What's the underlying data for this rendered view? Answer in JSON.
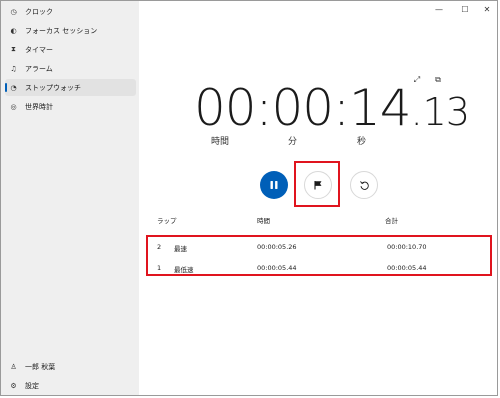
{
  "window": {
    "minimize_glyph": "—",
    "maximize_glyph": "☐",
    "close_glyph": "✕"
  },
  "sidebar": {
    "items": [
      {
        "label": "クロック",
        "icon": "clock-app-icon",
        "glyph": "◷"
      },
      {
        "label": "フォーカス セッション",
        "icon": "focus-icon",
        "glyph": "◐"
      },
      {
        "label": "タイマー",
        "icon": "hourglass-icon",
        "glyph": "⧗"
      },
      {
        "label": "アラーム",
        "icon": "bell-icon",
        "glyph": "♫"
      },
      {
        "label": "ストップウォッチ",
        "icon": "stopwatch-icon",
        "glyph": "◔",
        "active": true
      },
      {
        "label": "世界時計",
        "icon": "globe-icon",
        "glyph": "◎"
      }
    ],
    "user": {
      "label": "一郎 秋葉",
      "icon": "person-icon",
      "glyph": "♙"
    },
    "settings": {
      "label": "設定",
      "icon": "gear-icon",
      "glyph": "⚙"
    }
  },
  "stopwatch": {
    "time_main": "00:00:14",
    "time_dot": ".",
    "time_frac": "13",
    "units": {
      "hours": "時間",
      "minutes": "分",
      "seconds": "秒"
    },
    "expand_glyph": "⤢",
    "compact_glyph": "⧉"
  },
  "laps": {
    "headers": {
      "lap": "ラップ",
      "time": "時間",
      "total": "合計"
    },
    "rows": [
      {
        "num": "2",
        "tag": "最速",
        "time": "00:00:05.26",
        "total": "00:00:10.70"
      },
      {
        "num": "1",
        "tag": "最低速",
        "time": "00:00:05.44",
        "total": "00:00:05.44"
      }
    ]
  },
  "colors": {
    "accent": "#005fb8",
    "highlight": "#e0141e"
  }
}
